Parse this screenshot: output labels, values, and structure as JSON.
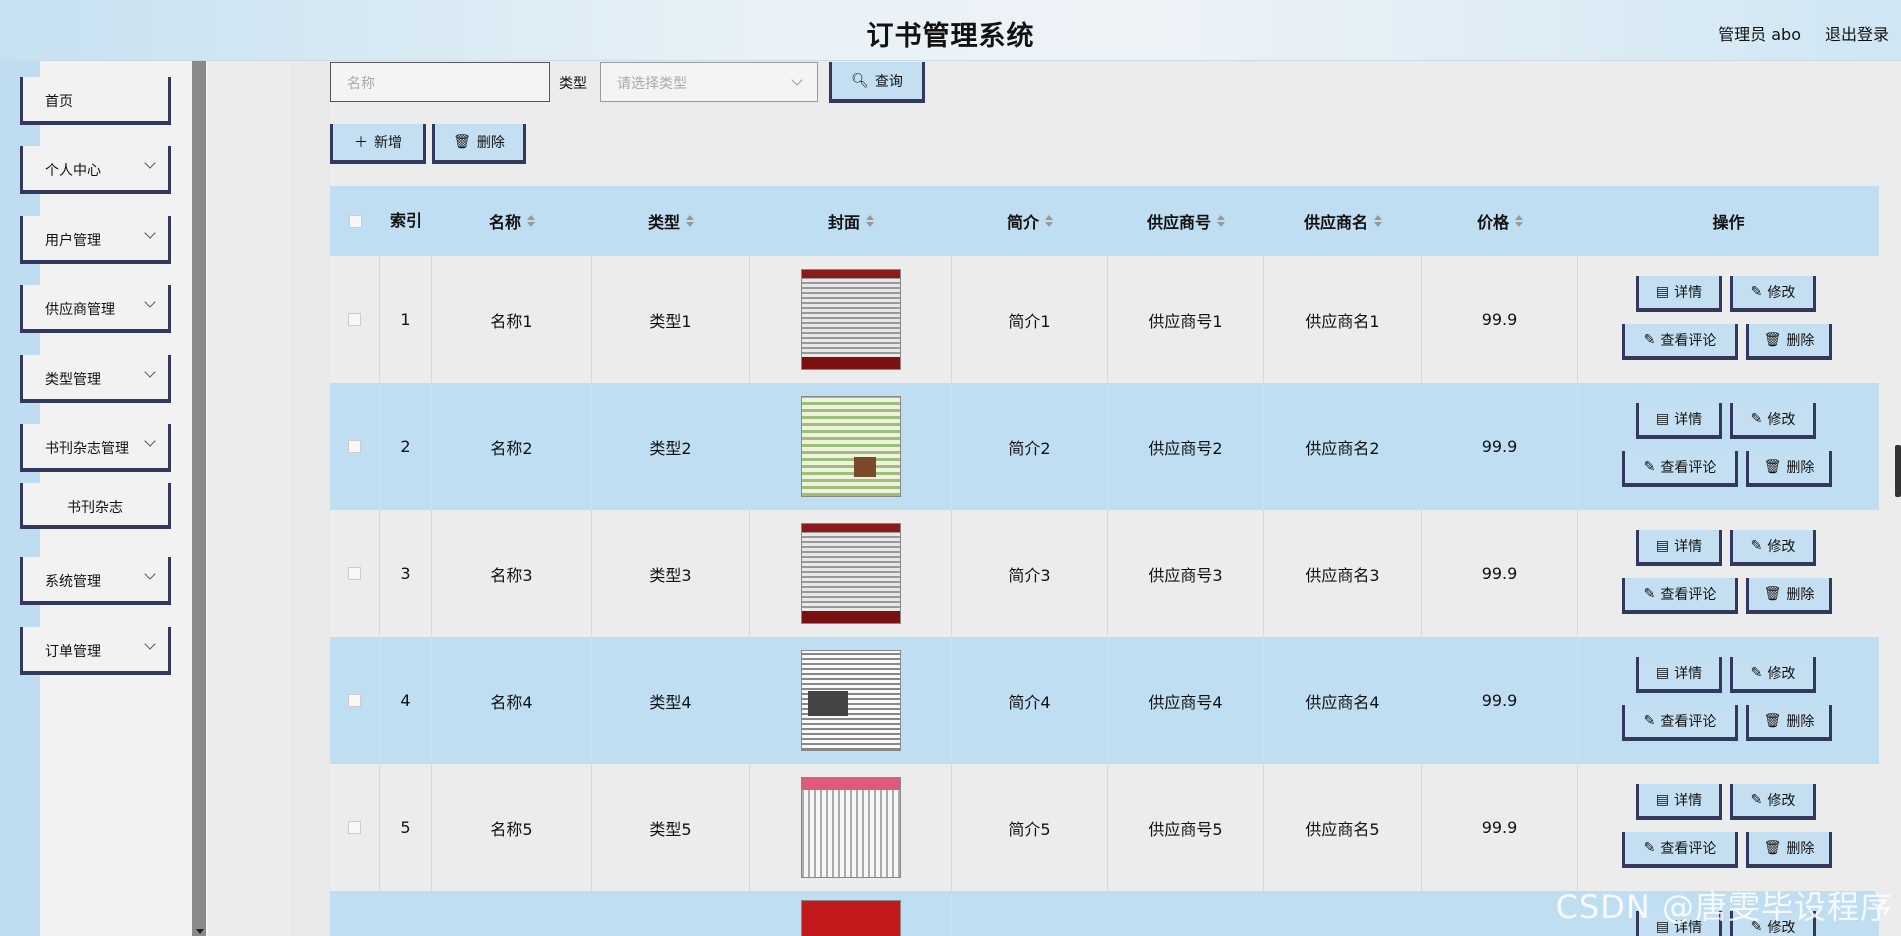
{
  "header": {
    "title": "订书管理系统",
    "user": "管理员 abo",
    "logout": "退出登录"
  },
  "sidebar": {
    "items": [
      {
        "label": "首页",
        "has_chevron": false
      },
      {
        "label": "个人中心",
        "has_chevron": true
      },
      {
        "label": "用户管理",
        "has_chevron": true
      },
      {
        "label": "供应商管理",
        "has_chevron": true
      },
      {
        "label": "类型管理",
        "has_chevron": true
      },
      {
        "label": "书刊杂志管理",
        "has_chevron": true
      },
      {
        "label": "书刊杂志",
        "has_chevron": false
      },
      {
        "label": "系统管理",
        "has_chevron": true
      },
      {
        "label": "订单管理",
        "has_chevron": true
      }
    ]
  },
  "search": {
    "name_placeholder": "名称",
    "type_label": "类型",
    "type_placeholder": "请选择类型",
    "query_button": "查询"
  },
  "toolbar": {
    "add_button": "新增",
    "delete_button": "删除"
  },
  "table": {
    "headers": {
      "index": "索引",
      "name": "名称",
      "type": "类型",
      "cover": "封面",
      "intro": "简介",
      "supplier_no": "供应商号",
      "supplier_name": "供应商名",
      "price": "价格",
      "actions": "操作"
    },
    "rows": [
      {
        "index": "1",
        "name": "名称1",
        "type": "类型1",
        "intro": "简介1",
        "supplier_no": "供应商号1",
        "supplier_name": "供应商名1",
        "price": "99.9"
      },
      {
        "index": "2",
        "name": "名称2",
        "type": "类型2",
        "intro": "简介2",
        "supplier_no": "供应商号2",
        "supplier_name": "供应商名2",
        "price": "99.9"
      },
      {
        "index": "3",
        "name": "名称3",
        "type": "类型3",
        "intro": "简介3",
        "supplier_no": "供应商号3",
        "supplier_name": "供应商名3",
        "price": "99.9"
      },
      {
        "index": "4",
        "name": "名称4",
        "type": "类型4",
        "intro": "简介4",
        "supplier_no": "供应商号4",
        "supplier_name": "供应商名4",
        "price": "99.9"
      },
      {
        "index": "5",
        "name": "名称5",
        "type": "类型5",
        "intro": "简介5",
        "supplier_no": "供应商号5",
        "supplier_name": "供应商名5",
        "price": "99.9"
      }
    ],
    "row_actions": {
      "detail": "详情",
      "edit": "修改",
      "comments": "查看评论",
      "delete": "删除"
    }
  },
  "watermark": "CSDN @唐雯毕设程序"
}
